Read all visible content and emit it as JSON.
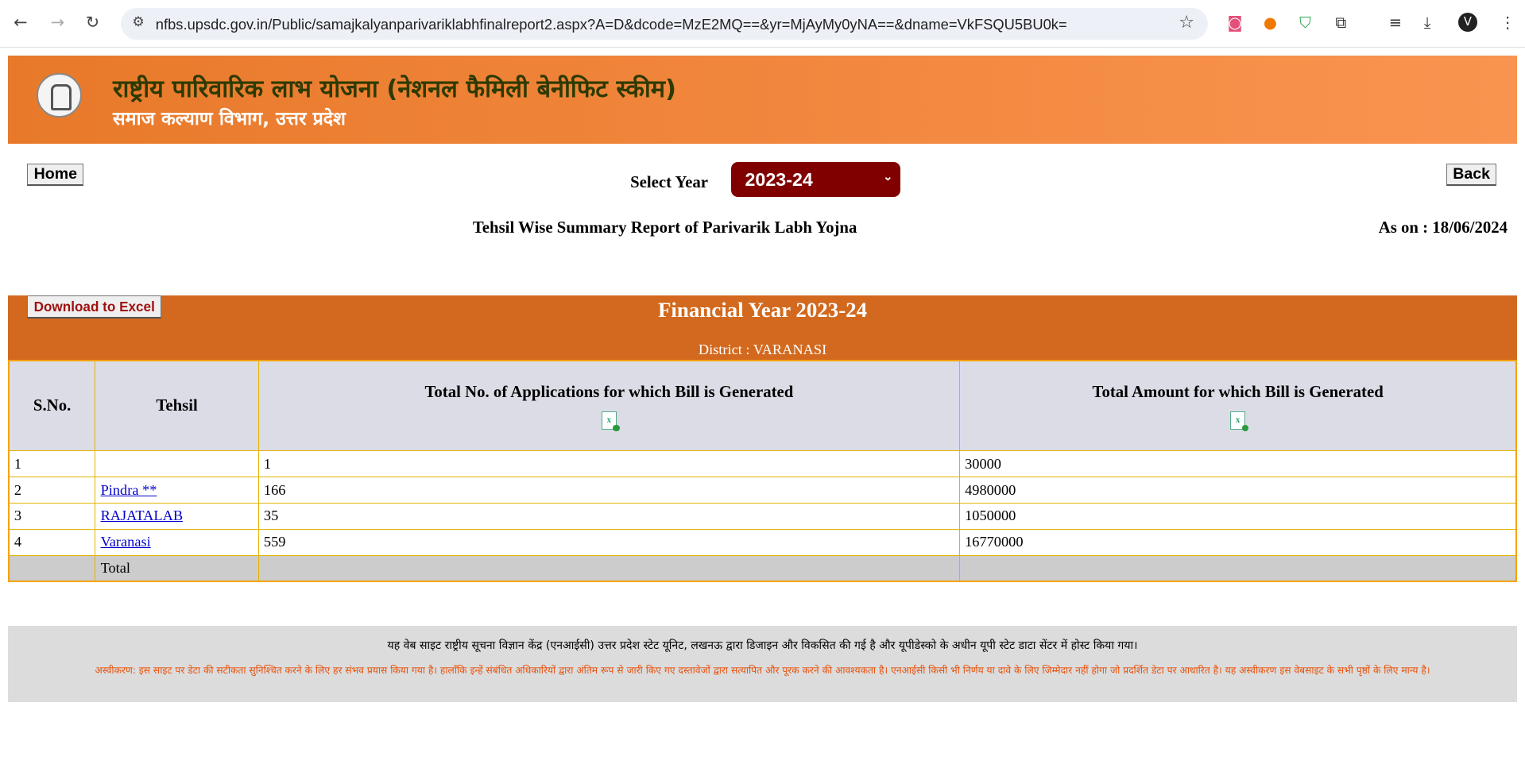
{
  "browser": {
    "url": "nfbs.upsdc.gov.in/Public/samajkalyanparivariklabhfinalreport2.aspx?A=D&dcode=MzE2MQ==&yr=MjAyMy0yNA==&dname=VkFSQU5BU0k="
  },
  "header": {
    "title": "राष्ट्रीय पारिवारिक लाभ योजना (नेशनल फैमिली बेनीफिट स्कीम)",
    "subtitle": "समाज कल्याण विभाग, उत्तर प्रदेश"
  },
  "controls": {
    "home": "Home",
    "back": "Back",
    "select_year_label": "Select Year",
    "year": "2023-24",
    "download": "Download to Excel"
  },
  "report": {
    "title": "Tehsil Wise Summary Report of Parivarik Labh Yojna",
    "as_on": "As on : 18/06/2024",
    "financial_year": "Financial Year  2023-24",
    "district": "District :  VARANASI"
  },
  "table": {
    "headers": [
      "S.No.",
      "Tehsil",
      "Total No. of Applications for which Bill is Generated",
      "Total Amount for which Bill is Generated"
    ],
    "rows": [
      [
        "1",
        "",
        "1",
        "30000"
      ],
      [
        "2",
        "Pindra **",
        "166",
        "4980000"
      ],
      [
        "3",
        "RAJATALAB",
        "35",
        "1050000"
      ],
      [
        "4",
        "Varanasi",
        "559",
        "16770000"
      ]
    ],
    "total_label": "Total"
  },
  "footer": {
    "line1": "यह वेब साइट राष्ट्रीय सूचना विज्ञान केंद्र (एनआईसी) उत्तर प्रदेश स्टेट यूनिट, लखनऊ द्वारा डिजाइन और विकसित की गई है और यूपीडेस्को के अधीन यूपी स्टेट डाटा सेंटर में होस्ट किया गया।",
    "disclaimer": "अस्वीकरण: इस साइट पर डेटा की सटीकता सुनिश्चित करने के लिए हर संभव प्रयास किया गया है। हालाँकि इन्हें संबंधित अधिकारियों द्वारा अंतिम रूप से जारी किए गए दस्तावेजों द्वारा सत्यापित और पूरक करने की आवश्यकता है। एनआईसी किसी भी निर्णय या दावे के लिए जिम्मेदार नहीं होगा जो प्रदर्शित डेटा पर आधारित है। यह अस्वीकरण इस वेबसाइट के सभी पृष्ठों के लिए मान्य है।"
  },
  "colors": {
    "banner": "#e8792a",
    "table_header": "#d2691e",
    "select": "#800000",
    "disclaimer": "#e8500a"
  }
}
